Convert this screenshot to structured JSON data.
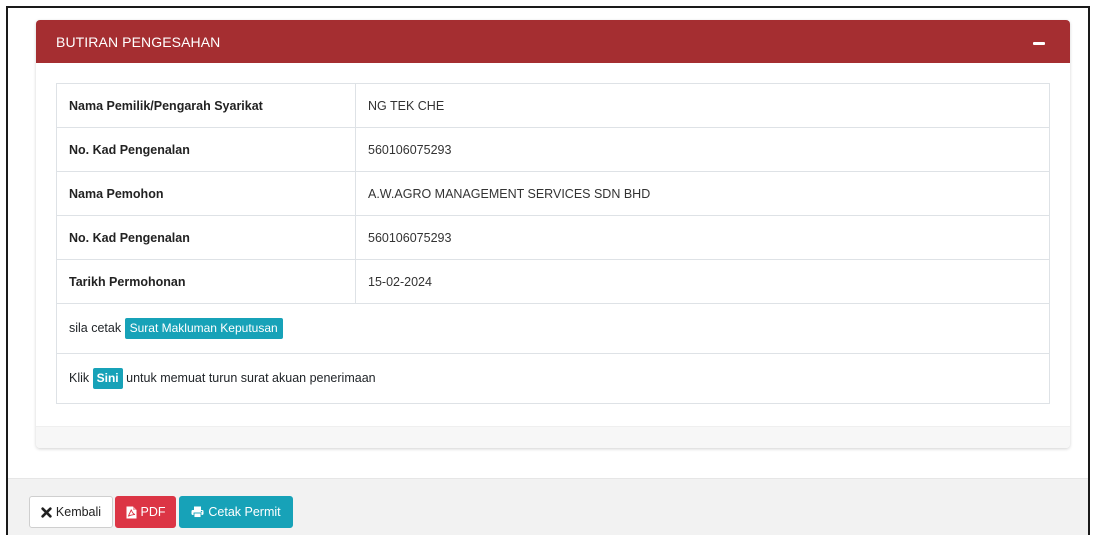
{
  "panel": {
    "title": "BUTIRAN PENGESAHAN"
  },
  "details": [
    {
      "label": "Nama Pemilik/Pengarah Syarikat",
      "value": "NG TEK CHE"
    },
    {
      "label": "No. Kad Pengenalan",
      "value": "560106075293"
    },
    {
      "label": "Nama Pemohon",
      "value": "A.W.AGRO MANAGEMENT SERVICES SDN BHD"
    },
    {
      "label": "No. Kad Pengenalan",
      "value": "560106075293"
    },
    {
      "label": "Tarikh Permohonan",
      "value": "15-02-2024"
    }
  ],
  "print_note": {
    "prefix": "sila cetak",
    "button_label": "Surat Makluman Keputusan"
  },
  "download_note": {
    "prefix": "Klik",
    "button_label": "Sini",
    "suffix": "untuk memuat turun surat akuan penerimaan"
  },
  "footer": {
    "back_label": "Kembali",
    "pdf_label": "PDF",
    "print_label": "Cetak Permit"
  },
  "colors": {
    "header_red": "#a52e31",
    "info": "#17a2b8",
    "danger": "#dc3545"
  },
  "icons": {
    "collapse": "minus-icon",
    "back": "times-icon",
    "pdf": "pdf-file-icon",
    "print": "print-icon"
  }
}
